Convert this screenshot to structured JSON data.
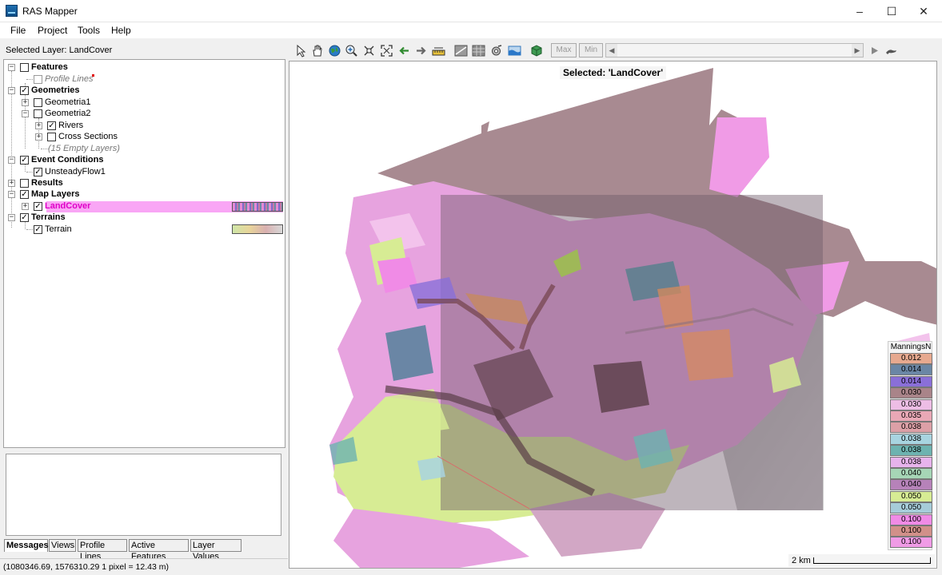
{
  "window": {
    "title": "RAS Mapper"
  },
  "menu": [
    "File",
    "Project",
    "Tools",
    "Help"
  ],
  "selected_layer_text": "Selected Layer: LandCover",
  "tree": {
    "features": "Features",
    "profile_lines": "Profile Lines",
    "geometries": "Geometries",
    "geometria1": "Geometria1",
    "geometria2": "Geometria2",
    "rivers": "Rivers",
    "cross_sections": "Cross Sections",
    "empty_layers": "(15 Empty Layers)",
    "event_conditions": "Event Conditions",
    "unsteadyflow1": "UnsteadyFlow1",
    "results": "Results",
    "map_layers": "Map Layers",
    "landcover": "LandCover",
    "terrains": "Terrains",
    "terrain": "Terrain"
  },
  "tabs": [
    "Messages",
    "Views",
    "Profile Lines",
    "Active Features",
    "Layer Values"
  ],
  "status_text": "(1080346.69, 1576310.29  1 pixel = 12.43 m)",
  "toolbar": {
    "max_label": "Max",
    "min_label": "Min"
  },
  "map": {
    "selected_label": "Selected: 'LandCover'",
    "legend_title": "ManningsN",
    "legend": [
      {
        "value": "0.012",
        "color": "#e7a98f"
      },
      {
        "value": "0.014",
        "color": "#6a86a5"
      },
      {
        "value": "0.014",
        "color": "#8a6fd8"
      },
      {
        "value": "0.030",
        "color": "#a98489"
      },
      {
        "value": "0.030",
        "color": "#edbde5"
      },
      {
        "value": "0.035",
        "color": "#e9a8b6"
      },
      {
        "value": "0.038",
        "color": "#dca0a7"
      },
      {
        "value": "0.038",
        "color": "#a8d4e0"
      },
      {
        "value": "0.038",
        "color": "#6db3b0"
      },
      {
        "value": "0.038",
        "color": "#e7b3ec"
      },
      {
        "value": "0.040",
        "color": "#a6d6b6"
      },
      {
        "value": "0.040",
        "color": "#b682b9"
      },
      {
        "value": "0.050",
        "color": "#d7ec94"
      },
      {
        "value": "0.050",
        "color": "#a6ccd9"
      },
      {
        "value": "0.100",
        "color": "#f08be6"
      },
      {
        "value": "0.100",
        "color": "#d19089"
      },
      {
        "value": "0.100",
        "color": "#f09be6"
      }
    ],
    "scale_label": "2 km"
  }
}
